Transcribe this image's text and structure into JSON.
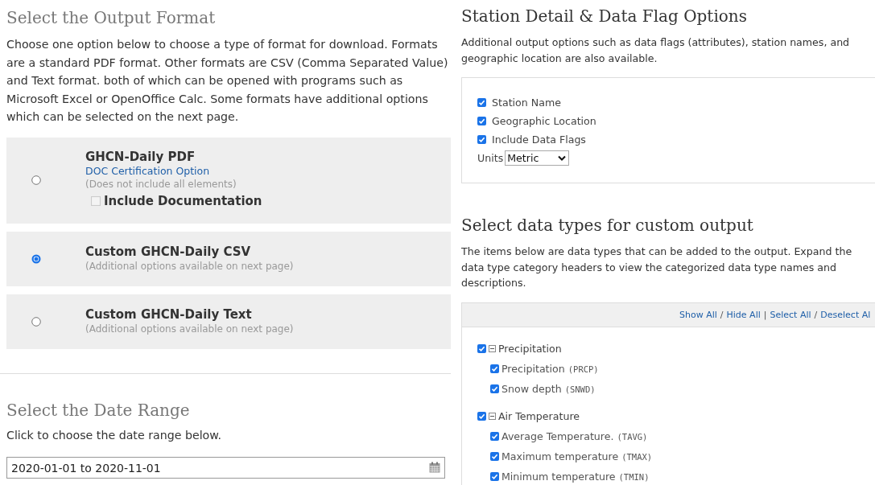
{
  "output_format": {
    "title": "Select the Output Format",
    "intro": "Choose one option below to choose a type of format for download. Formats are a standard PDF format. Other formats are CSV (Comma Separated Value) and Text format. both of which can be opened with programs such as Microsoft Excel or OpenOffice Calc. Some formats have additional options which can be selected on the next page.",
    "options": [
      {
        "label": "GHCN-Daily PDF",
        "link": "DOC Certification Option",
        "note": "(Does not include all elements)",
        "extra": {
          "label": "Include Documentation",
          "checked": false
        },
        "selected": false
      },
      {
        "label": "Custom GHCN-Daily CSV",
        "note": "(Additional options available on next page)",
        "selected": true
      },
      {
        "label": "Custom GHCN-Daily Text",
        "note": "(Additional options available on next page)",
        "selected": false
      }
    ]
  },
  "date_range": {
    "title": "Select the Date Range",
    "hint": "Click to choose the date range below.",
    "value": "2020-01-01 to 2020-11-01"
  },
  "station_options": {
    "title": "Station Detail & Data Flag Options",
    "intro": "Additional output options such as data flags (attributes), station names, and geographic location are also available.",
    "checkboxes": [
      {
        "label": "Station Name",
        "checked": true
      },
      {
        "label": "Geographic Location",
        "checked": true
      },
      {
        "label": "Include Data Flags",
        "checked": true
      }
    ],
    "units": {
      "label": "Units",
      "value": "Metric"
    }
  },
  "data_types": {
    "title": "Select data types for custom output",
    "intro": "The items below are data types that can be added to the output. Expand the data type category headers to view the categorized data type names and descriptions.",
    "links": [
      "Show All",
      "Hide All",
      "Select All",
      "Deselect Al"
    ],
    "separators": [
      "/",
      "|",
      "/"
    ],
    "categories": [
      {
        "label": "Precipitation",
        "checked": true,
        "expanded": true,
        "children": [
          {
            "label": "Precipitation",
            "code": "(PRCP)",
            "checked": true
          },
          {
            "label": "Snow depth",
            "code": "(SNWD)",
            "checked": true
          }
        ]
      },
      {
        "label": "Air Temperature",
        "checked": true,
        "expanded": true,
        "children": [
          {
            "label": "Average Temperature.",
            "code": "(TAVG)",
            "checked": true
          },
          {
            "label": "Maximum temperature",
            "code": "(TMAX)",
            "checked": true
          },
          {
            "label": "Minimum temperature",
            "code": "(TMIN)",
            "checked": true
          }
        ]
      }
    ]
  }
}
